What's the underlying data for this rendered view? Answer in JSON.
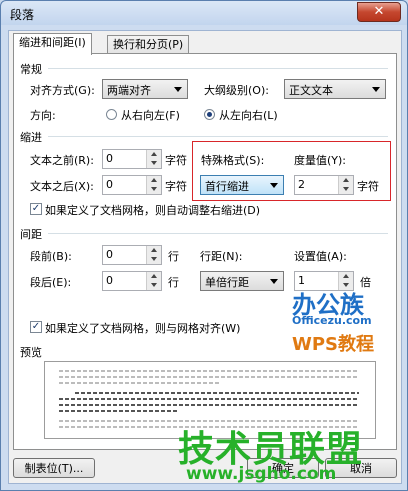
{
  "window": {
    "title": "段落",
    "close_glyph": "✕"
  },
  "tabs": [
    {
      "label": "缩进和间距(I)"
    },
    {
      "label": "换行和分页(P)"
    }
  ],
  "general": {
    "heading": "常规",
    "alignment_label": "对齐方式(G):",
    "alignment_value": "两端对齐",
    "outline_label": "大纲级别(O):",
    "outline_value": "正文文本",
    "direction_label": "方向:",
    "direction_rtl": "从右向左(F)",
    "direction_ltr": "从左向右(L)"
  },
  "indent": {
    "heading": "缩进",
    "before_label": "文本之前(R):",
    "before_value": "0",
    "before_unit": "字符",
    "after_label": "文本之后(X):",
    "after_value": "0",
    "after_unit": "字符",
    "special_label": "特殊格式(S):",
    "special_value": "首行缩进",
    "measure_label": "度量值(Y):",
    "measure_value": "2",
    "measure_unit": "字符",
    "grid_check_label": "如果定义了文档网格，则自动调整右缩进(D)"
  },
  "spacing": {
    "heading": "间距",
    "before_label": "段前(B):",
    "before_value": "0",
    "before_unit": "行",
    "after_label": "段后(E):",
    "after_value": "0",
    "after_unit": "行",
    "line_label": "行距(N):",
    "line_value": "单倍行距",
    "setting_label": "设置值(A):",
    "setting_value": "1",
    "setting_unit": "倍",
    "grid_check_label": "如果定义了文档网格，则与网格对齐(W)"
  },
  "preview": {
    "heading": "预览"
  },
  "buttons": {
    "tabs": "制表位(T)...",
    "ok": "确定",
    "cancel": "取消"
  },
  "watermarks": {
    "brand_cn": "办公族",
    "brand_url": "Officezu.com",
    "brand_wps": "WPS教程",
    "site_cn": "技术员联盟",
    "site_url": "www.jsgho.com"
  }
}
